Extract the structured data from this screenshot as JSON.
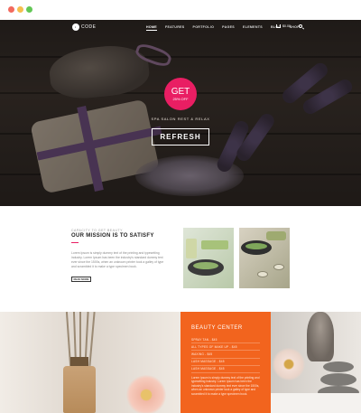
{
  "nav": {
    "logo_text": "CODE",
    "logo_mark": "i",
    "menu": [
      "HOME",
      "FEATURES",
      "PORTFOLIO",
      "PAGES",
      "ELEMENTS",
      "BLOG",
      "SHOP"
    ],
    "cart_label": "$0.00",
    "icons": [
      "cart-icon",
      "search-icon"
    ]
  },
  "hero": {
    "promo_main": "GET",
    "promo_sub": "25% OFF",
    "tagline": "SPA SALON REST & RELAX",
    "button_label": "REFRESH",
    "badge_color": "#e91e63"
  },
  "mission": {
    "eyebrow": "CAPACITY TO GET BEAUTY",
    "title": "OUR MISSION IS TO SATISFY",
    "body": "Lorem Ipsum is simply dummy text of the printing and typesetting industry. Lorem Ipsum has been the industry's standard dummy text ever since the 1500s, when an unknown printer took a galley of type and scrambled it to make a type specimen book.",
    "button_label": "READ MORE",
    "accent_color": "#e91e63"
  },
  "beauty": {
    "title": "BEAUTY CENTER",
    "items": [
      "SPRAY TAN - $45",
      "ALL TYPES OF MAKE UP - $45",
      "WAXING - $45",
      "LASH MASSAGE - $45",
      "LASH MASSAGE - $45"
    ],
    "body": "Lorem Ipsum is simply dummy text of the printing and typesetting industry. Lorem Ipsum has been the industry's standard dummy text ever since the 1500s, when an unknown printer took a galley of type and scrambled it to make a type specimen book.",
    "background_color": "#f2641e"
  }
}
